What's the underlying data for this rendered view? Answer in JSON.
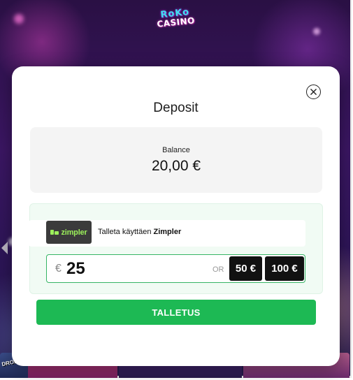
{
  "brand": {
    "logo_line1": "RoKo",
    "logo_line2": "CASINO",
    "banner_label": "DROPS WINS"
  },
  "modal": {
    "title": "Deposit",
    "close_icon": "close-icon",
    "balance": {
      "label": "Balance",
      "value": "20,00 €"
    },
    "payment_method": {
      "logo_text": "zimpler",
      "text_prefix": "Talleta käyttäen",
      "method_name": "Zimpler"
    },
    "amount": {
      "currency_symbol": "€",
      "value": "25",
      "or_label": "OR",
      "quick_amounts": [
        "50 €",
        "100 €"
      ]
    },
    "submit_label": "TALLETUS"
  },
  "colors": {
    "accent_green": "#1db954",
    "input_border": "#36b565",
    "zimpler_green": "#9cf05a",
    "backdrop_purple": "#3b1663"
  }
}
